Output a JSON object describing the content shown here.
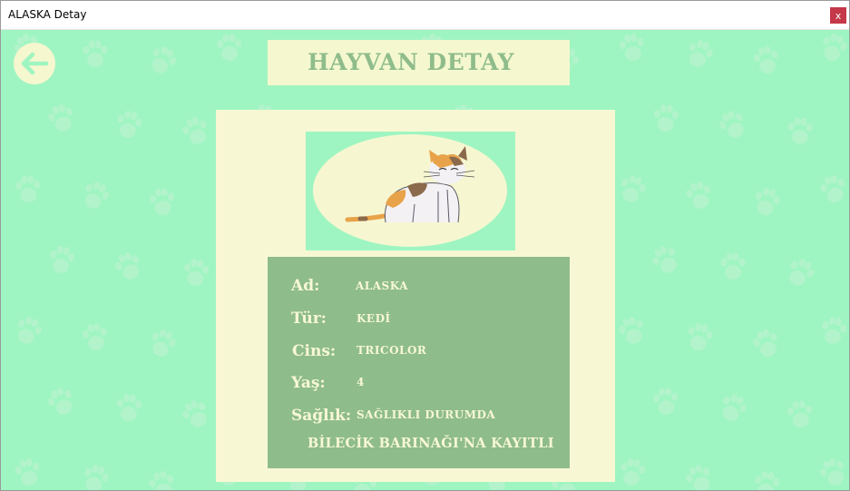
{
  "window": {
    "title": "ALASKA Detay",
    "close_label": "x"
  },
  "header": {
    "title": "HAYVAN DETAY"
  },
  "colors": {
    "background": "#9ff5c1",
    "panel": "#f7f8d3",
    "info_panel": "#8fbc8b",
    "header_text": "#8fbc8b",
    "close_button": "#c4384a"
  },
  "icons": {
    "back": "arrow-left-icon",
    "pattern": "paw-print-icon"
  },
  "animal": {
    "fields": [
      {
        "label": "Ad:",
        "value": "ALASKA"
      },
      {
        "label": "Tür:",
        "value": "KEDİ"
      },
      {
        "label": "Cins:",
        "value": "TRICOLOR"
      },
      {
        "label": "Yaş:",
        "value": "4"
      },
      {
        "label": "Sağlık:",
        "value": "SAĞLIKLI DURUMDA"
      }
    ],
    "registration_note": "BİLECİK BARINAĞI'NA KAYITLI"
  }
}
